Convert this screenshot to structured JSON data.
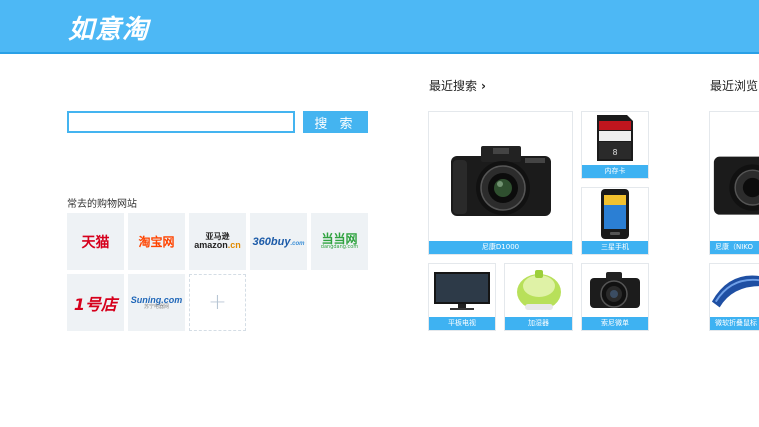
{
  "header": {
    "logo": "如意淘"
  },
  "search": {
    "value": "",
    "placeholder": "",
    "button_label": "搜 索"
  },
  "sites": {
    "title": "常去的购物网站",
    "items": [
      {
        "name": "天猫",
        "icon": "tmall-logo"
      },
      {
        "name": "淘宝网",
        "icon": "taobao-logo"
      },
      {
        "name_cn": "亚马逊",
        "name_en": "amazon",
        "suffix": ".cn",
        "icon": "amazon-logo"
      },
      {
        "name": "360buy",
        "suffix": ".com",
        "icon": "360buy-logo"
      },
      {
        "name_cn": "当当网",
        "name_en": "dangdang.com",
        "icon": "dangdang-logo"
      },
      {
        "name": "1号店",
        "icon": "yhd-logo"
      },
      {
        "name_en": "Suning.com",
        "name_cn": "苏宁电器网",
        "icon": "suning-logo"
      }
    ],
    "add_icon": "plus-icon",
    "add_label": "+"
  },
  "recent_search": {
    "title": "最近搜索",
    "chevron": "›",
    "items": [
      {
        "label": "尼康D1000",
        "icon": "dslr-camera"
      },
      {
        "label": "内存卡",
        "icon": "sd-card"
      },
      {
        "label": "三星手机",
        "icon": "smartphone"
      },
      {
        "label": "平板电视",
        "icon": "flat-tv"
      },
      {
        "label": "加湿器",
        "icon": "humidifier"
      },
      {
        "label": "索尼微单",
        "icon": "mirrorless-camera"
      }
    ]
  },
  "recent_browse": {
    "title": "最近浏览",
    "items": [
      {
        "label": "尼康（NIKO",
        "icon": "dslr-camera"
      },
      {
        "label": "微软折叠鼠标",
        "icon": "arc-mouse"
      }
    ]
  },
  "colors": {
    "header": "#4db8f5",
    "accent": "#44b4f0",
    "caption": "#3eb2f2",
    "tile": "#eef2f5"
  }
}
